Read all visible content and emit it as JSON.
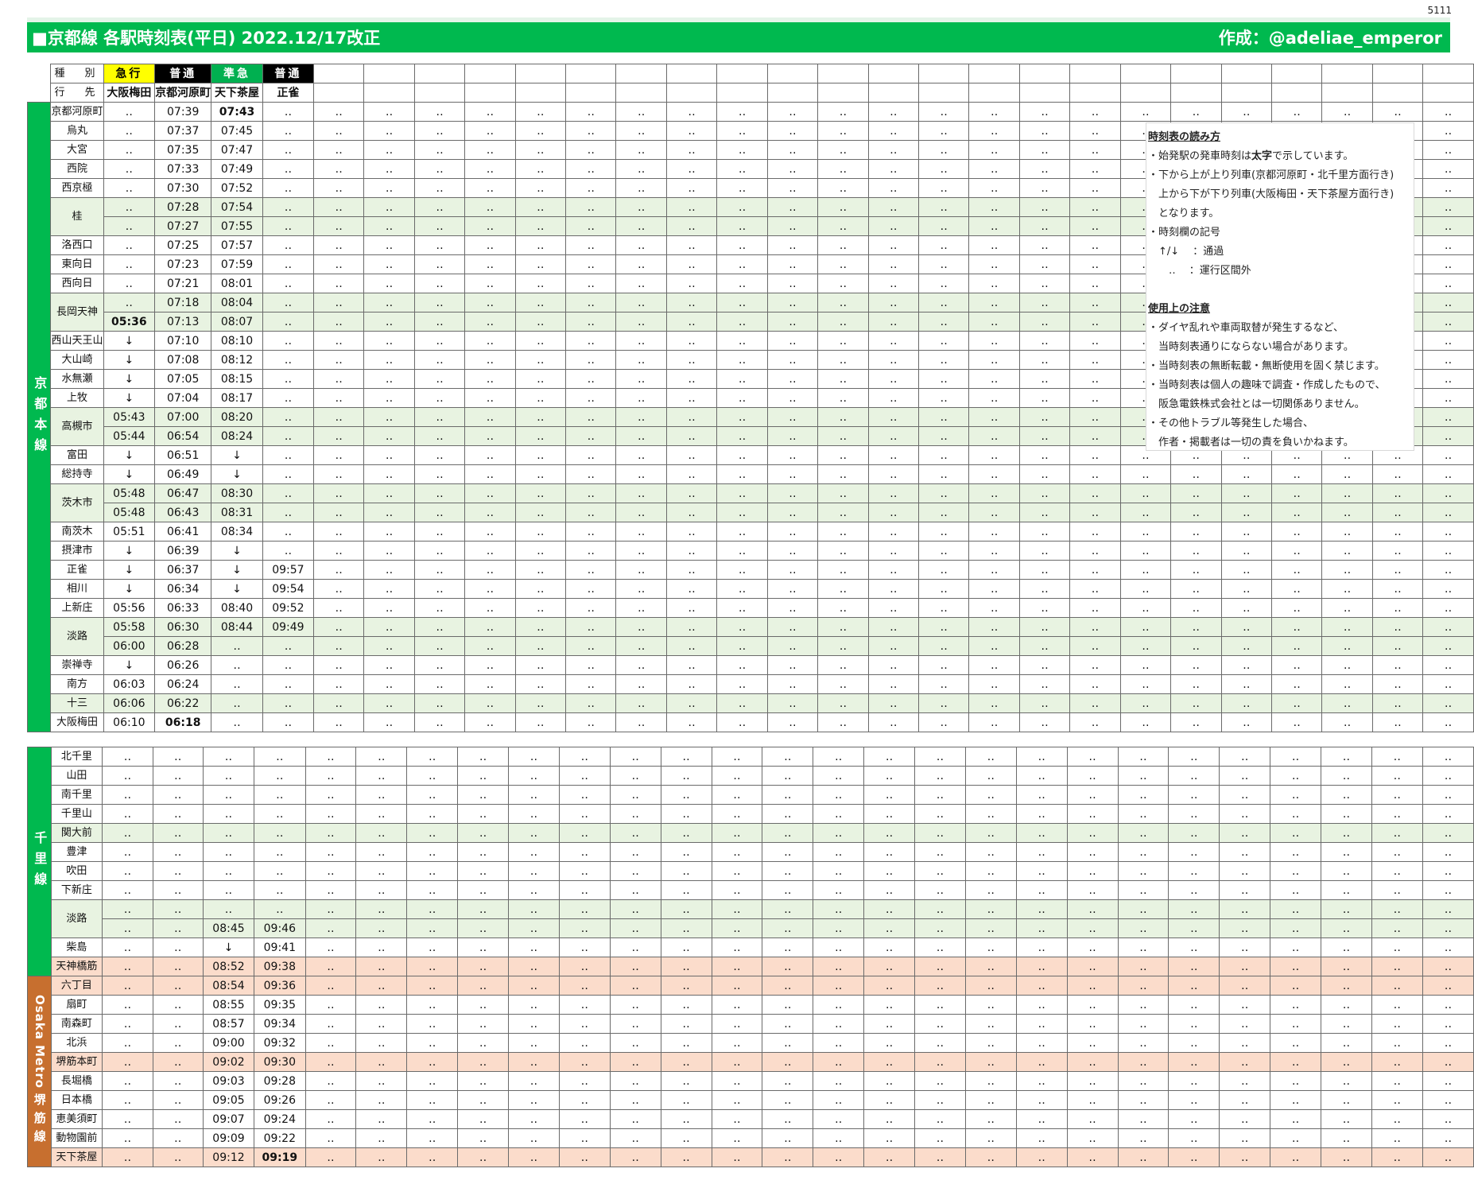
{
  "page_number": "5111",
  "title": "■京都線 各駅時刻表(平日) 2022.12/17改正",
  "author": "作成：@adeliae_emperor",
  "header": {
    "type_label": "種　別",
    "dest_label": "行　先",
    "trains": [
      {
        "type": "急行",
        "dest": "大阪梅田",
        "bg": "#ffff00",
        "fg": "#000000"
      },
      {
        "type": "普通",
        "dest": "京都河原町",
        "bg": "#000000",
        "fg": "#ffffff"
      },
      {
        "type": "準急",
        "dest": "天下茶屋",
        "bg": "#00b050",
        "fg": "#ffffff"
      },
      {
        "type": "普通",
        "dest": "正雀",
        "bg": "#000000",
        "fg": "#ffffff"
      }
    ]
  },
  "lines": [
    {
      "name": "京都本線",
      "color": "#00b94f"
    },
    {
      "name": "千里線",
      "color": "#00b94f"
    },
    {
      "name": "Osaka Metro",
      "color": "#c76f2f"
    },
    {
      "name": "堺筋線",
      "color": "#c76f2f"
    }
  ],
  "kyoto_stations": [
    {
      "name": "京都河原町",
      "times": [
        "‥",
        "07:39",
        "07:43",
        "‥"
      ],
      "bold": [
        2
      ]
    },
    {
      "name": "烏丸",
      "times": [
        "‥",
        "07:37",
        "07:45",
        "‥"
      ]
    },
    {
      "name": "大宮",
      "times": [
        "‥",
        "07:35",
        "07:47",
        "‥"
      ]
    },
    {
      "name": "西院",
      "times": [
        "‥",
        "07:33",
        "07:49",
        "‥"
      ]
    },
    {
      "name": "西京極",
      "times": [
        "‥",
        "07:30",
        "07:52",
        "‥"
      ]
    },
    {
      "name": "桂",
      "rows": [
        [
          "‥",
          "07:28",
          "07:54",
          "‥"
        ],
        [
          "‥",
          "07:27",
          "07:55",
          "‥"
        ]
      ],
      "shade": "green"
    },
    {
      "name": "洛西口",
      "times": [
        "‥",
        "07:25",
        "07:57",
        "‥"
      ]
    },
    {
      "name": "東向日",
      "times": [
        "‥",
        "07:23",
        "07:59",
        "‥"
      ]
    },
    {
      "name": "西向日",
      "times": [
        "‥",
        "07:21",
        "08:01",
        "‥"
      ]
    },
    {
      "name": "長岡天神",
      "rows": [
        [
          "‥",
          "07:18",
          "08:04",
          "‥"
        ],
        [
          "05:36",
          "07:13",
          "08:07",
          "‥"
        ]
      ],
      "shade": "green",
      "bold_row1": [
        0
      ]
    },
    {
      "name": "西山天王山",
      "times": [
        "↓",
        "07:10",
        "08:10",
        "‥"
      ]
    },
    {
      "name": "大山崎",
      "times": [
        "↓",
        "07:08",
        "08:12",
        "‥"
      ]
    },
    {
      "name": "水無瀬",
      "times": [
        "↓",
        "07:05",
        "08:15",
        "‥"
      ]
    },
    {
      "name": "上牧",
      "times": [
        "↓",
        "07:04",
        "08:17",
        "‥"
      ]
    },
    {
      "name": "高槻市",
      "rows": [
        [
          "05:43",
          "07:00",
          "08:20",
          "‥"
        ],
        [
          "05:44",
          "06:54",
          "08:24",
          "‥"
        ]
      ],
      "shade": "green"
    },
    {
      "name": "富田",
      "times": [
        "↓",
        "06:51",
        "↓",
        "‥"
      ]
    },
    {
      "name": "総持寺",
      "times": [
        "↓",
        "06:49",
        "↓",
        "‥"
      ]
    },
    {
      "name": "茨木市",
      "rows": [
        [
          "05:48",
          "06:47",
          "08:30",
          "‥"
        ],
        [
          "05:48",
          "06:43",
          "08:31",
          "‥"
        ]
      ],
      "shade": "green"
    },
    {
      "name": "南茨木",
      "times": [
        "05:51",
        "06:41",
        "08:34",
        "‥"
      ]
    },
    {
      "name": "摂津市",
      "times": [
        "↓",
        "06:39",
        "↓",
        "‥"
      ]
    },
    {
      "name": "正雀",
      "times": [
        "↓",
        "06:37",
        "↓",
        "09:57"
      ]
    },
    {
      "name": "相川",
      "times": [
        "↓",
        "06:34",
        "↓",
        "09:54"
      ]
    },
    {
      "name": "上新庄",
      "times": [
        "05:56",
        "06:33",
        "08:40",
        "09:52"
      ]
    },
    {
      "name": "淡路",
      "rows": [
        [
          "05:58",
          "06:30",
          "08:44",
          "09:49"
        ],
        [
          "06:00",
          "06:28",
          "‥",
          "‥"
        ]
      ],
      "shade": "green"
    },
    {
      "name": "崇禅寺",
      "times": [
        "↓",
        "06:26",
        "‥",
        "‥"
      ]
    },
    {
      "name": "南方",
      "times": [
        "06:03",
        "06:24",
        "‥",
        "‥"
      ]
    },
    {
      "name": "十三",
      "times": [
        "06:06",
        "06:22",
        "‥",
        "‥"
      ],
      "shade": "green"
    },
    {
      "name": "大阪梅田",
      "times": [
        "06:10",
        "06:18",
        "‥",
        "‥"
      ],
      "bold": [
        1
      ]
    }
  ],
  "senri_stations": [
    {
      "name": "北千里",
      "times": [
        "‥",
        "‥",
        "‥",
        "‥"
      ]
    },
    {
      "name": "山田",
      "times": [
        "‥",
        "‥",
        "‥",
        "‥"
      ]
    },
    {
      "name": "南千里",
      "times": [
        "‥",
        "‥",
        "‥",
        "‥"
      ]
    },
    {
      "name": "千里山",
      "times": [
        "‥",
        "‥",
        "‥",
        "‥"
      ]
    },
    {
      "name": "関大前",
      "times": [
        "‥",
        "‥",
        "‥",
        "‥"
      ],
      "shade": "green"
    },
    {
      "name": "豊津",
      "times": [
        "‥",
        "‥",
        "‥",
        "‥"
      ]
    },
    {
      "name": "吹田",
      "times": [
        "‥",
        "‥",
        "‥",
        "‥"
      ]
    },
    {
      "name": "下新庄",
      "times": [
        "‥",
        "‥",
        "‥",
        "‥"
      ]
    },
    {
      "name": "淡路",
      "rows": [
        [
          "‥",
          "‥",
          "‥",
          "‥"
        ],
        [
          "‥",
          "‥",
          "08:45",
          "09:46"
        ]
      ],
      "shade": "green"
    },
    {
      "name": "柴島",
      "times": [
        "‥",
        "‥",
        "↓",
        "09:41"
      ]
    },
    {
      "name": "天神橋筋",
      "times": [
        "‥",
        "‥",
        "08:52",
        "09:38"
      ],
      "shade": "orange"
    }
  ],
  "metro_stations": [
    {
      "name": "六丁目",
      "times": [
        "‥",
        "‥",
        "08:54",
        "09:36"
      ],
      "shade": "orange"
    },
    {
      "name": "扇町",
      "times": [
        "‥",
        "‥",
        "08:55",
        "09:35"
      ]
    },
    {
      "name": "南森町",
      "times": [
        "‥",
        "‥",
        "08:57",
        "09:34"
      ]
    },
    {
      "name": "北浜",
      "times": [
        "‥",
        "‥",
        "09:00",
        "09:32"
      ]
    },
    {
      "name": "堺筋本町",
      "times": [
        "‥",
        "‥",
        "09:02",
        "09:30"
      ],
      "shade": "orange"
    },
    {
      "name": "長堀橋",
      "times": [
        "‥",
        "‥",
        "09:03",
        "09:28"
      ]
    },
    {
      "name": "日本橋",
      "times": [
        "‥",
        "‥",
        "09:05",
        "09:26"
      ]
    },
    {
      "name": "恵美須町",
      "times": [
        "‥",
        "‥",
        "09:07",
        "09:24"
      ]
    },
    {
      "name": "動物園前",
      "times": [
        "‥",
        "‥",
        "09:09",
        "09:22"
      ]
    },
    {
      "name": "天下茶屋",
      "times": [
        "‥",
        "‥",
        "09:12",
        "09:19"
      ],
      "shade": "orange",
      "bold": [
        3
      ]
    }
  ],
  "empty_cell": "‥",
  "notes": {
    "heading1": "時刻表の読み方",
    "line1_pre": "・始発駅の発車時刻は",
    "line1_bold": "太字",
    "line1_post": "で示しています。",
    "line2": "・下から上が上り列車(京都河原町・北千里方面行き)",
    "line3": "　上から下が下り列車(大阪梅田・天下茶屋方面行き)",
    "line4": "　となります。",
    "line5": "・時刻欄の記号",
    "line6": "　↑/↓　 ：通過",
    "line7": "　　‥　 ：運行区間外",
    "heading2": "使用上の注意",
    "line8": "・ダイヤ乱れや車両取替が発生するなど、",
    "line9": "　当時刻表通りにならない場合があります。",
    "line10": "・当時刻表の無断転載・無断使用を固く禁じます。",
    "line11": "・当時刻表は個人の趣味で調査・作成したもので、",
    "line12": "　阪急電鉄株式会社とは一切関係ありません。",
    "line13": "・その他トラブル等発生した場合、",
    "line14": "　作者・掲載者は一切の責を負いかねます。"
  }
}
